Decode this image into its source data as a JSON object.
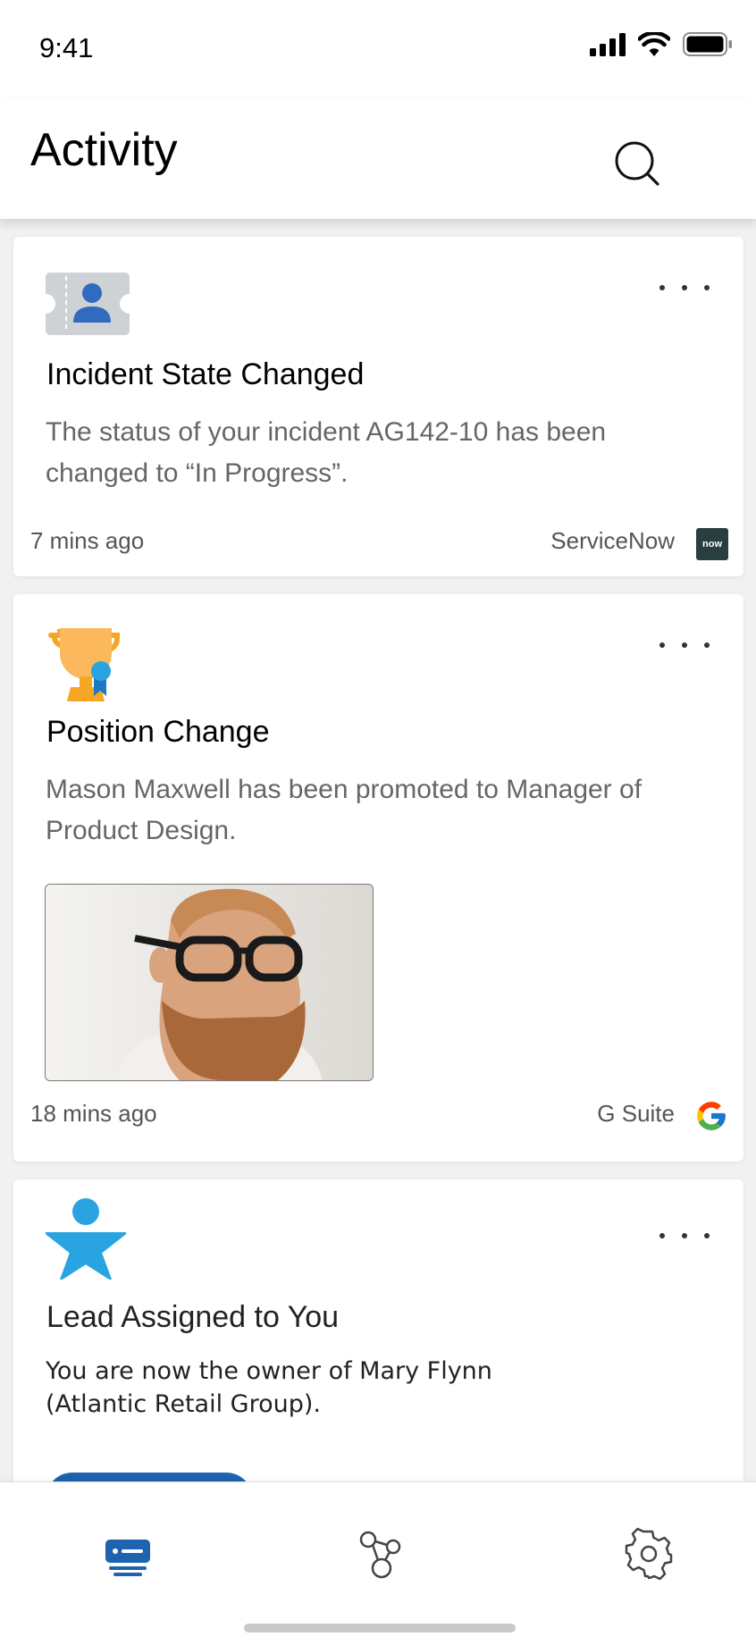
{
  "status_bar": {
    "time": "9:41"
  },
  "header": {
    "title": "Activity",
    "search_icon": "search-icon"
  },
  "cards": [
    {
      "icon": "ticket-person-icon",
      "title": "Incident State Changed",
      "body": "The status of your incident AG142-10 has been changed to “In Progress”.",
      "time": "7 mins ago",
      "source": "ServiceNow",
      "source_logo_text": "now"
    },
    {
      "icon": "trophy-icon",
      "title": "Position Change",
      "body": "Mason Maxwell has been promoted to Manager of Product Design.",
      "time": "18 mins ago",
      "source": "G Suite",
      "source_logo_text": "G"
    },
    {
      "icon": "star-person-icon",
      "title": "Lead Assigned to You",
      "body": "You are now the owner of Mary Flynn (Atlantic Retail Group)."
    }
  ],
  "bottom_nav": [
    {
      "icon": "activity-feed-icon",
      "active": true
    },
    {
      "icon": "connections-icon",
      "active": false
    },
    {
      "icon": "settings-icon",
      "active": false
    }
  ],
  "colors": {
    "accent": "#1f62b0",
    "trophy": "#f5a623",
    "star": "#2aa4e0",
    "servicenow_bg": "#293e40"
  }
}
